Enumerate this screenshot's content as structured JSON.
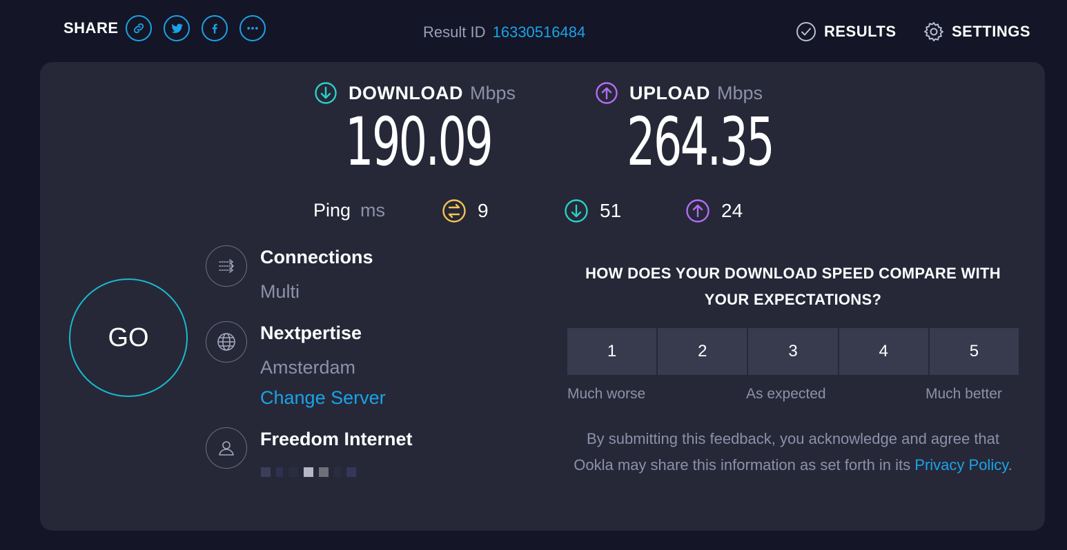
{
  "header": {
    "share_label": "SHARE",
    "share_buttons": [
      "link-icon",
      "twitter-icon",
      "facebook-icon",
      "more-icon"
    ],
    "result_id_label": "Result ID",
    "result_id": "16330516484",
    "results_label": "RESULTS",
    "settings_label": "SETTINGS"
  },
  "download": {
    "label": "DOWNLOAD",
    "unit": "Mbps",
    "value": "190.09",
    "color": "#2bd1c7"
  },
  "upload": {
    "label": "UPLOAD",
    "unit": "Mbps",
    "value": "264.35",
    "color": "#b56cf5"
  },
  "ping": {
    "label": "Ping",
    "unit": "ms",
    "idle": "9",
    "download": "51",
    "upload": "24",
    "idle_color": "#f5c451"
  },
  "go_label": "GO",
  "connections": {
    "title": "Connections",
    "value": "Multi"
  },
  "server": {
    "title": "Nextpertise",
    "location": "Amsterdam",
    "change_label": "Change Server"
  },
  "isp": {
    "title": "Freedom Internet"
  },
  "feedback": {
    "question": "HOW DOES YOUR DOWNLOAD SPEED COMPARE WITH YOUR EXPECTATIONS?",
    "ratings": [
      "1",
      "2",
      "3",
      "4",
      "5"
    ],
    "scale_low": "Much worse",
    "scale_mid": "As expected",
    "scale_high": "Much better",
    "disclaimer_text": "By submitting this feedback, you acknowledge and agree that Ookla may share this information as set forth in its",
    "privacy_link": "Privacy Policy",
    "disclaimer_end": "."
  },
  "colors": {
    "accent": "#1ba3e8",
    "background": "#141526",
    "panel": "#262838"
  }
}
